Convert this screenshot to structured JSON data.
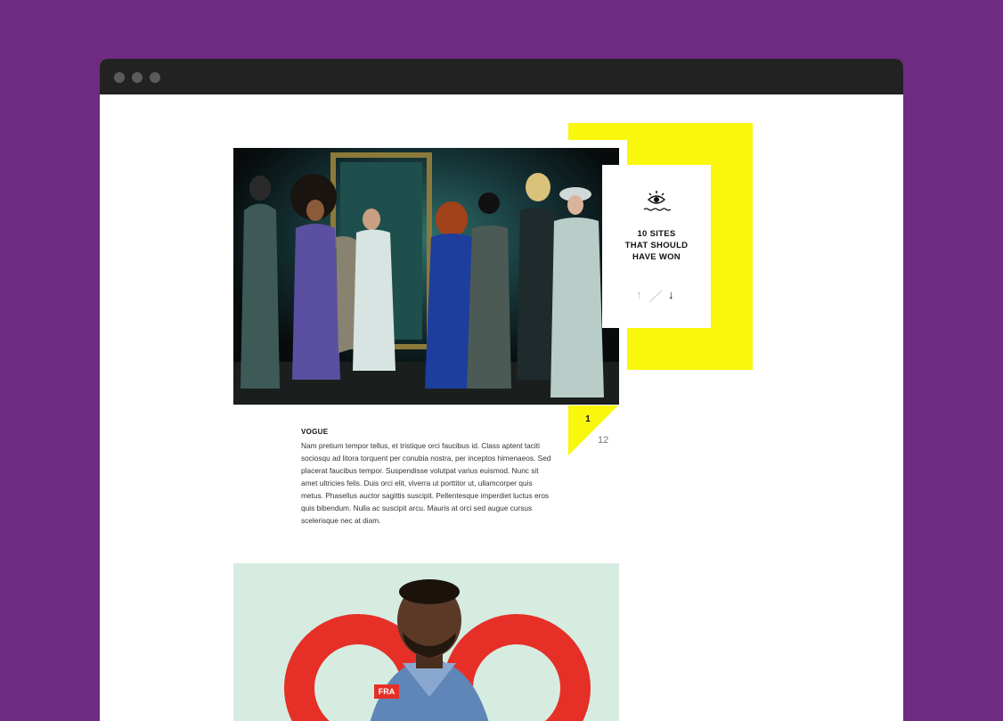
{
  "card": {
    "icon": "eye-waves-icon",
    "title_line1": "10 SITES",
    "title_line2": "THAT SHOULD",
    "title_line3": "HAVE WON",
    "prev_icon": "arrow-up-icon",
    "next_icon": "arrow-down-icon"
  },
  "counter": {
    "current": "1",
    "total": "12"
  },
  "article": {
    "title": "VOGUE",
    "body": "Nam pretium tempor tellus, et tristique orci faucibus id. Class aptent taciti sociosqu ad litora torquent per conubia nostra, per inceptos himenaeos. Sed placerat faucibus tempor. Suspendisse volutpat varius euismod. Nunc sit amet ultricies felis. Duis orci elit, viverra ut porttitor ut, ullamcorper quis metus. Phasellus auctor sagittis suscipit. Pellentesque imperdiet luctus eros quis bibendum. Nulla ac suscipit arcu. Mauris at orci sed augue cursus scelerisque nec at diam."
  },
  "gq_cover": {
    "cover_text": "FRA"
  },
  "colors": {
    "background": "#6f2a82",
    "accent_yellow": "#f8f70c",
    "titlebar": "#222222",
    "gq_red": "#e63027",
    "gq_bg": "#d6ece1"
  }
}
